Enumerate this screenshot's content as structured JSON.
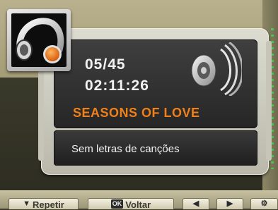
{
  "player": {
    "track_counter": "05/45",
    "elapsed_time": "02:11:26",
    "song_title": "SEASONS OF LOVE",
    "lyrics_status": "Sem letras de canções"
  },
  "icons": {
    "app": "headphones-icon",
    "speaker": "speaker-volume-icon"
  },
  "colors": {
    "title_accent": "#f0801a",
    "panel_bg": "#2e2e2e",
    "frame": "#c9c8bb"
  },
  "bottom_bar": {
    "repeat_label": "Repetir",
    "ok_key": "OK",
    "back_label": "Voltar"
  }
}
